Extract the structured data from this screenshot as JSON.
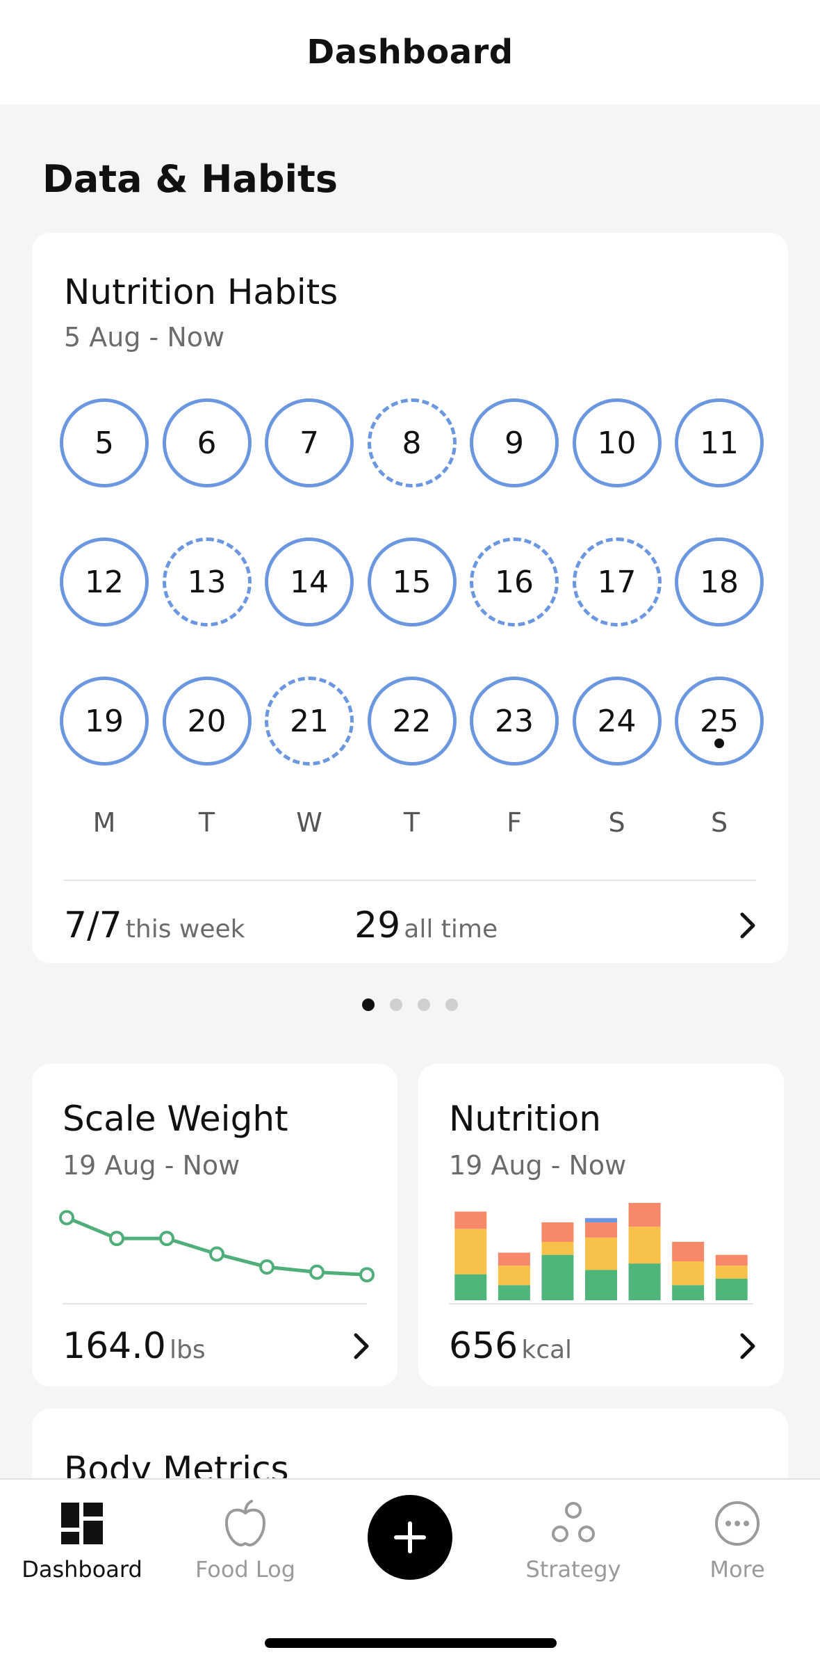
{
  "header": {
    "title": "Dashboard"
  },
  "section": {
    "title": "Data & Habits"
  },
  "habits": {
    "title": "Nutrition Habits",
    "subtitle": "5 Aug - Now",
    "days": [
      {
        "label": "5",
        "done": true
      },
      {
        "label": "6",
        "done": true
      },
      {
        "label": "7",
        "done": true
      },
      {
        "label": "8",
        "done": false
      },
      {
        "label": "9",
        "done": true
      },
      {
        "label": "10",
        "done": true
      },
      {
        "label": "11",
        "done": true
      },
      {
        "label": "12",
        "done": true
      },
      {
        "label": "13",
        "done": false
      },
      {
        "label": "14",
        "done": true
      },
      {
        "label": "15",
        "done": true
      },
      {
        "label": "16",
        "done": false
      },
      {
        "label": "17",
        "done": false
      },
      {
        "label": "18",
        "done": true
      },
      {
        "label": "19",
        "done": true
      },
      {
        "label": "20",
        "done": true
      },
      {
        "label": "21",
        "done": false
      },
      {
        "label": "22",
        "done": true
      },
      {
        "label": "23",
        "done": true
      },
      {
        "label": "24",
        "done": true
      },
      {
        "label": "25",
        "done": true,
        "today": true
      }
    ],
    "weekdays": [
      "M",
      "T",
      "W",
      "T",
      "F",
      "S",
      "S"
    ],
    "week_value": "7/7",
    "week_label": "this week",
    "all_value": "29",
    "all_label": "all time"
  },
  "pager": {
    "count": 4,
    "active": 0
  },
  "weight": {
    "title": "Scale Weight",
    "subtitle": "19 Aug - Now",
    "value": "164.0",
    "unit": "lbs",
    "color": "#4fae7a"
  },
  "nutrition": {
    "title": "Nutrition",
    "subtitle": "19 Aug - Now",
    "value": "656",
    "unit": "kcal",
    "colors": {
      "protein": "#4fb57b",
      "carbs": "#f8c24a",
      "fat": "#f7896a",
      "alcohol": "#6a97e0"
    }
  },
  "body": {
    "title": "Body Metrics"
  },
  "chart_data": [
    {
      "type": "line",
      "x": [
        1,
        2,
        3,
        4,
        5,
        6,
        7
      ],
      "series": [
        {
          "values": [
            166.2,
            165.4,
            165.4,
            164.8,
            164.3,
            164.1,
            164.0
          ]
        }
      ],
      "ylim": [
        163.5,
        166.5
      ]
    },
    {
      "type": "bar",
      "categories": [
        "1",
        "2",
        "3",
        "4",
        "5",
        "6",
        "7"
      ],
      "stacked": true,
      "series": [
        {
          "values": [
            12,
            7,
            21,
            14,
            17,
            7,
            10
          ]
        },
        {
          "values": [
            21,
            9,
            6,
            15,
            17,
            11,
            6
          ]
        },
        {
          "values": [
            8,
            6,
            9,
            7,
            11,
            9,
            5
          ]
        },
        {
          "values": [
            0,
            0,
            0,
            2,
            0,
            0,
            0
          ]
        }
      ],
      "ylim": [
        0,
        45
      ]
    }
  ],
  "nav": {
    "items": [
      {
        "label": "Dashboard",
        "icon": "dashboard-icon",
        "active": true
      },
      {
        "label": "Food Log",
        "icon": "apple-icon",
        "active": false
      },
      {
        "label": "Strategy",
        "icon": "strategy-icon",
        "active": false
      },
      {
        "label": "More",
        "icon": "more-icon",
        "active": false
      }
    ]
  }
}
